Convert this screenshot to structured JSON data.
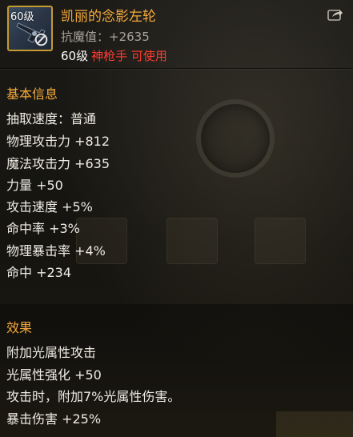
{
  "item": {
    "level_tag": "60级",
    "name": "凯丽的念影左轮",
    "resist_stat": "抗魔值：+2635",
    "required_level": "60级",
    "required_class": "神枪手 可使用"
  },
  "basic_info": {
    "title": "基本信息",
    "lines": [
      "抽取速度：普通",
      "物理攻击力 +812",
      "魔法攻击力 +635",
      "力量 +50",
      "攻击速度 +5%",
      "命中率 +3%",
      "物理暴击率 +4%",
      "命中 +234"
    ]
  },
  "effects": {
    "title": "效果",
    "lines": [
      "附加光属性攻击",
      "光属性强化 +50",
      "攻击时，附加7%光属性伤害。",
      "暴击伤害 +25%"
    ]
  },
  "colors": {
    "title_orange": "#f3a93b",
    "class_red": "#ff3b30",
    "icon_border_gold": "#c49a32",
    "text_main": "#efebe4",
    "text_dim": "#a7a39b"
  },
  "icons": {
    "item": "revolver-icon",
    "restricted": "ban-icon",
    "share": "share-icon"
  }
}
